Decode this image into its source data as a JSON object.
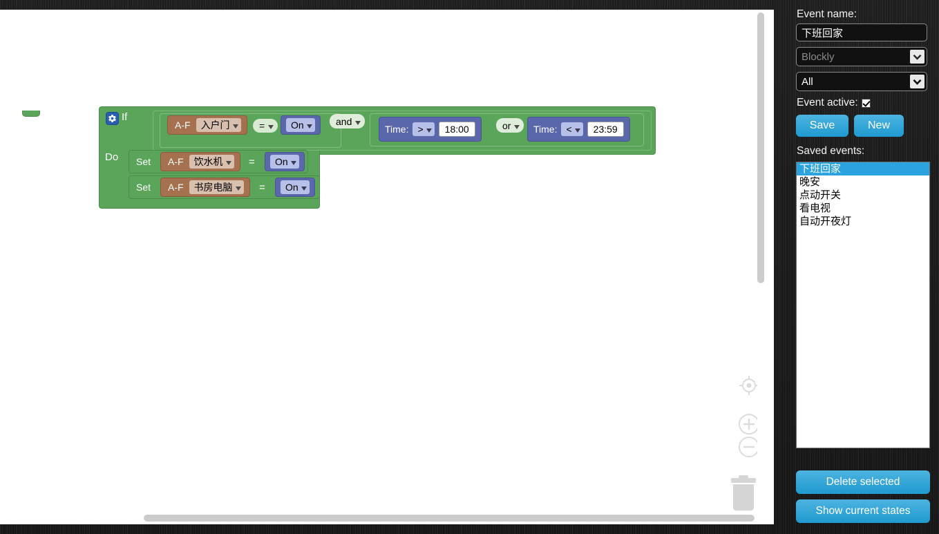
{
  "workspace": {
    "if_label": "If",
    "do_label": "Do",
    "gear_icon": "gear-icon",
    "condition_row": {
      "compare_1": {
        "device_prefix": "A-F",
        "device_name": "入户门",
        "operator": "=",
        "state": "On"
      },
      "joiner_1": "and",
      "time_compare_1": {
        "label": "Time:",
        "operator": ">",
        "value": "18:00"
      },
      "joiner_2": "or",
      "time_compare_2": {
        "label": "Time:",
        "operator": "<",
        "value": "23:59"
      }
    },
    "actions": [
      {
        "set_label": "Set",
        "device_prefix": "A-F",
        "device_name": "饮水机",
        "operator": "=",
        "state": "On"
      },
      {
        "set_label": "Set",
        "device_prefix": "A-F",
        "device_name": "书房电脑",
        "operator": "=",
        "state": "On"
      }
    ],
    "controls": {
      "center_icon": "crosshair-target-icon",
      "zoom_in_icon": "zoom-in-icon",
      "zoom_out_icon": "zoom-out-icon",
      "trash_icon": "trash-can-icon"
    },
    "colors": {
      "control_block": "#5ba55b",
      "device_block": "#a5714e",
      "state_block": "#5b67ab",
      "field_green": "#d9ead3",
      "gear_blue": "#2a5db0"
    }
  },
  "panel": {
    "event_name_label": "Event name:",
    "event_name_value": "下班回家",
    "event_name_placeholder": "",
    "editor_select_value": "Blockly",
    "filter_select_value": "All",
    "event_active_label": "Event active:",
    "event_active_checked": true,
    "save_label": "Save",
    "new_label": "New",
    "saved_events_label": "Saved events:",
    "saved_events": [
      "下班回家",
      "晚安",
      "点动开关",
      "看电视",
      "自动开夜灯"
    ],
    "selected_event_index": 0,
    "delete_selected_label": "Delete selected",
    "show_current_states_label": "Show current states",
    "accent_color": "#2aa3e0"
  }
}
